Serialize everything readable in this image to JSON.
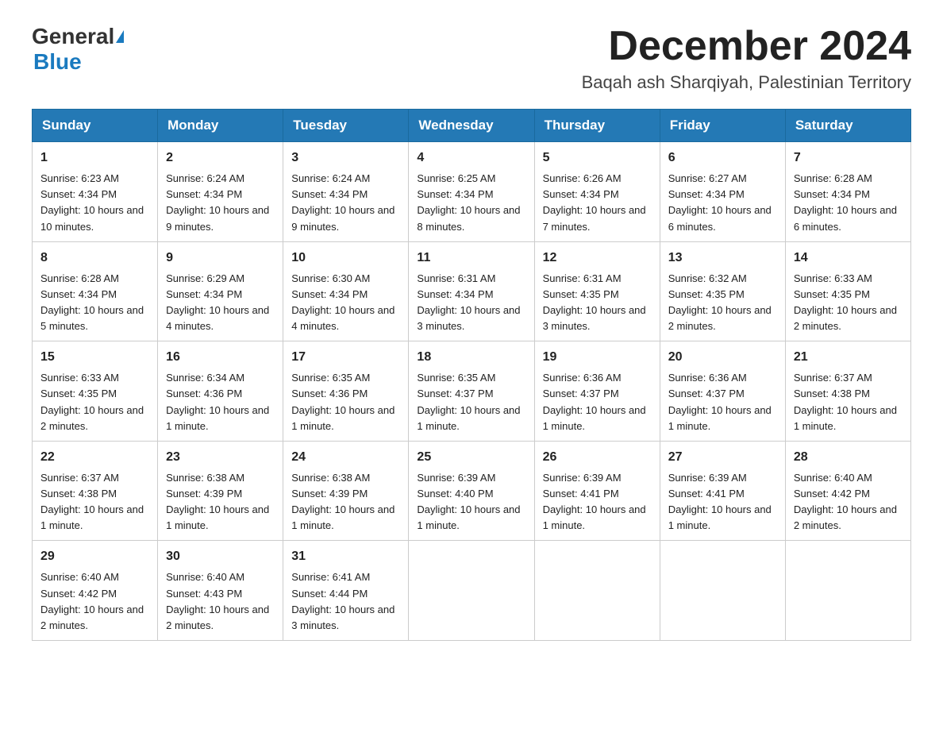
{
  "header": {
    "logo_general": "General",
    "logo_blue": "Blue",
    "month_title": "December 2024",
    "location": "Baqah ash Sharqiyah, Palestinian Territory"
  },
  "weekdays": [
    "Sunday",
    "Monday",
    "Tuesday",
    "Wednesday",
    "Thursday",
    "Friday",
    "Saturday"
  ],
  "weeks": [
    [
      {
        "day": "1",
        "sunrise": "Sunrise: 6:23 AM",
        "sunset": "Sunset: 4:34 PM",
        "daylight": "Daylight: 10 hours and 10 minutes."
      },
      {
        "day": "2",
        "sunrise": "Sunrise: 6:24 AM",
        "sunset": "Sunset: 4:34 PM",
        "daylight": "Daylight: 10 hours and 9 minutes."
      },
      {
        "day": "3",
        "sunrise": "Sunrise: 6:24 AM",
        "sunset": "Sunset: 4:34 PM",
        "daylight": "Daylight: 10 hours and 9 minutes."
      },
      {
        "day": "4",
        "sunrise": "Sunrise: 6:25 AM",
        "sunset": "Sunset: 4:34 PM",
        "daylight": "Daylight: 10 hours and 8 minutes."
      },
      {
        "day": "5",
        "sunrise": "Sunrise: 6:26 AM",
        "sunset": "Sunset: 4:34 PM",
        "daylight": "Daylight: 10 hours and 7 minutes."
      },
      {
        "day": "6",
        "sunrise": "Sunrise: 6:27 AM",
        "sunset": "Sunset: 4:34 PM",
        "daylight": "Daylight: 10 hours and 6 minutes."
      },
      {
        "day": "7",
        "sunrise": "Sunrise: 6:28 AM",
        "sunset": "Sunset: 4:34 PM",
        "daylight": "Daylight: 10 hours and 6 minutes."
      }
    ],
    [
      {
        "day": "8",
        "sunrise": "Sunrise: 6:28 AM",
        "sunset": "Sunset: 4:34 PM",
        "daylight": "Daylight: 10 hours and 5 minutes."
      },
      {
        "day": "9",
        "sunrise": "Sunrise: 6:29 AM",
        "sunset": "Sunset: 4:34 PM",
        "daylight": "Daylight: 10 hours and 4 minutes."
      },
      {
        "day": "10",
        "sunrise": "Sunrise: 6:30 AM",
        "sunset": "Sunset: 4:34 PM",
        "daylight": "Daylight: 10 hours and 4 minutes."
      },
      {
        "day": "11",
        "sunrise": "Sunrise: 6:31 AM",
        "sunset": "Sunset: 4:34 PM",
        "daylight": "Daylight: 10 hours and 3 minutes."
      },
      {
        "day": "12",
        "sunrise": "Sunrise: 6:31 AM",
        "sunset": "Sunset: 4:35 PM",
        "daylight": "Daylight: 10 hours and 3 minutes."
      },
      {
        "day": "13",
        "sunrise": "Sunrise: 6:32 AM",
        "sunset": "Sunset: 4:35 PM",
        "daylight": "Daylight: 10 hours and 2 minutes."
      },
      {
        "day": "14",
        "sunrise": "Sunrise: 6:33 AM",
        "sunset": "Sunset: 4:35 PM",
        "daylight": "Daylight: 10 hours and 2 minutes."
      }
    ],
    [
      {
        "day": "15",
        "sunrise": "Sunrise: 6:33 AM",
        "sunset": "Sunset: 4:35 PM",
        "daylight": "Daylight: 10 hours and 2 minutes."
      },
      {
        "day": "16",
        "sunrise": "Sunrise: 6:34 AM",
        "sunset": "Sunset: 4:36 PM",
        "daylight": "Daylight: 10 hours and 1 minute."
      },
      {
        "day": "17",
        "sunrise": "Sunrise: 6:35 AM",
        "sunset": "Sunset: 4:36 PM",
        "daylight": "Daylight: 10 hours and 1 minute."
      },
      {
        "day": "18",
        "sunrise": "Sunrise: 6:35 AM",
        "sunset": "Sunset: 4:37 PM",
        "daylight": "Daylight: 10 hours and 1 minute."
      },
      {
        "day": "19",
        "sunrise": "Sunrise: 6:36 AM",
        "sunset": "Sunset: 4:37 PM",
        "daylight": "Daylight: 10 hours and 1 minute."
      },
      {
        "day": "20",
        "sunrise": "Sunrise: 6:36 AM",
        "sunset": "Sunset: 4:37 PM",
        "daylight": "Daylight: 10 hours and 1 minute."
      },
      {
        "day": "21",
        "sunrise": "Sunrise: 6:37 AM",
        "sunset": "Sunset: 4:38 PM",
        "daylight": "Daylight: 10 hours and 1 minute."
      }
    ],
    [
      {
        "day": "22",
        "sunrise": "Sunrise: 6:37 AM",
        "sunset": "Sunset: 4:38 PM",
        "daylight": "Daylight: 10 hours and 1 minute."
      },
      {
        "day": "23",
        "sunrise": "Sunrise: 6:38 AM",
        "sunset": "Sunset: 4:39 PM",
        "daylight": "Daylight: 10 hours and 1 minute."
      },
      {
        "day": "24",
        "sunrise": "Sunrise: 6:38 AM",
        "sunset": "Sunset: 4:39 PM",
        "daylight": "Daylight: 10 hours and 1 minute."
      },
      {
        "day": "25",
        "sunrise": "Sunrise: 6:39 AM",
        "sunset": "Sunset: 4:40 PM",
        "daylight": "Daylight: 10 hours and 1 minute."
      },
      {
        "day": "26",
        "sunrise": "Sunrise: 6:39 AM",
        "sunset": "Sunset: 4:41 PM",
        "daylight": "Daylight: 10 hours and 1 minute."
      },
      {
        "day": "27",
        "sunrise": "Sunrise: 6:39 AM",
        "sunset": "Sunset: 4:41 PM",
        "daylight": "Daylight: 10 hours and 1 minute."
      },
      {
        "day": "28",
        "sunrise": "Sunrise: 6:40 AM",
        "sunset": "Sunset: 4:42 PM",
        "daylight": "Daylight: 10 hours and 2 minutes."
      }
    ],
    [
      {
        "day": "29",
        "sunrise": "Sunrise: 6:40 AM",
        "sunset": "Sunset: 4:42 PM",
        "daylight": "Daylight: 10 hours and 2 minutes."
      },
      {
        "day": "30",
        "sunrise": "Sunrise: 6:40 AM",
        "sunset": "Sunset: 4:43 PM",
        "daylight": "Daylight: 10 hours and 2 minutes."
      },
      {
        "day": "31",
        "sunrise": "Sunrise: 6:41 AM",
        "sunset": "Sunset: 4:44 PM",
        "daylight": "Daylight: 10 hours and 3 minutes."
      },
      null,
      null,
      null,
      null
    ]
  ]
}
